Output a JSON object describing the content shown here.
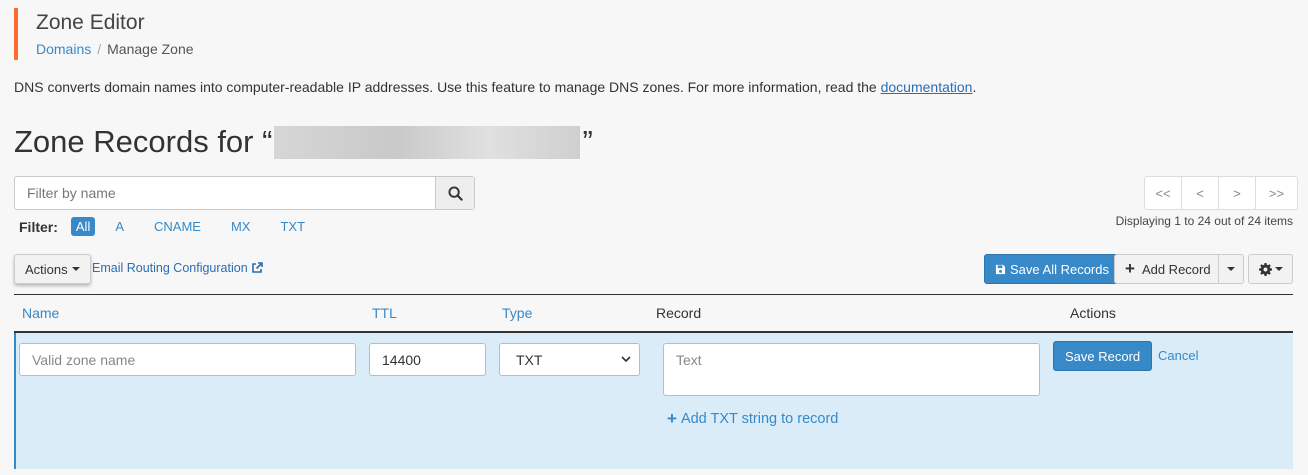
{
  "header": {
    "title": "Zone Editor",
    "breadcrumb": {
      "root": "Domains",
      "current": "Manage Zone",
      "separator": "/"
    }
  },
  "intro": {
    "text": "DNS converts domain names into computer-readable IP addresses. Use this feature to manage DNS zones. For more information, read the ",
    "link": "documentation",
    "suffix": "."
  },
  "zone": {
    "prefix": "Zone Records for “",
    "suffix": "”"
  },
  "search": {
    "placeholder": "Filter by name"
  },
  "filter": {
    "label": "Filter:",
    "items": [
      "All",
      "A",
      "CNAME",
      "MX",
      "TXT"
    ],
    "active": "All"
  },
  "pager": {
    "first": "<<",
    "prev": "<",
    "next": ">",
    "last": ">>"
  },
  "displaying": "Displaying 1 to 24 out of 24 items",
  "toolbar": {
    "actions": "Actions",
    "email_routing": "Email Routing Configuration",
    "save_all": "Save All Records",
    "add_record": "Add Record"
  },
  "table": {
    "headers": {
      "name": "Name",
      "ttl": "TTL",
      "type": "Type",
      "record": "Record",
      "actions": "Actions"
    }
  },
  "edit_row": {
    "name_placeholder": "Valid zone name",
    "ttl_value": "14400",
    "type_value": "TXT",
    "record_placeholder": "Text",
    "save": "Save Record",
    "cancel": "Cancel",
    "add_txt": "Add TXT string to record"
  },
  "colors": {
    "accent": "#3789c8",
    "header_bar": "#ff6c2c",
    "edit_row_bg": "#d9ecf8"
  }
}
